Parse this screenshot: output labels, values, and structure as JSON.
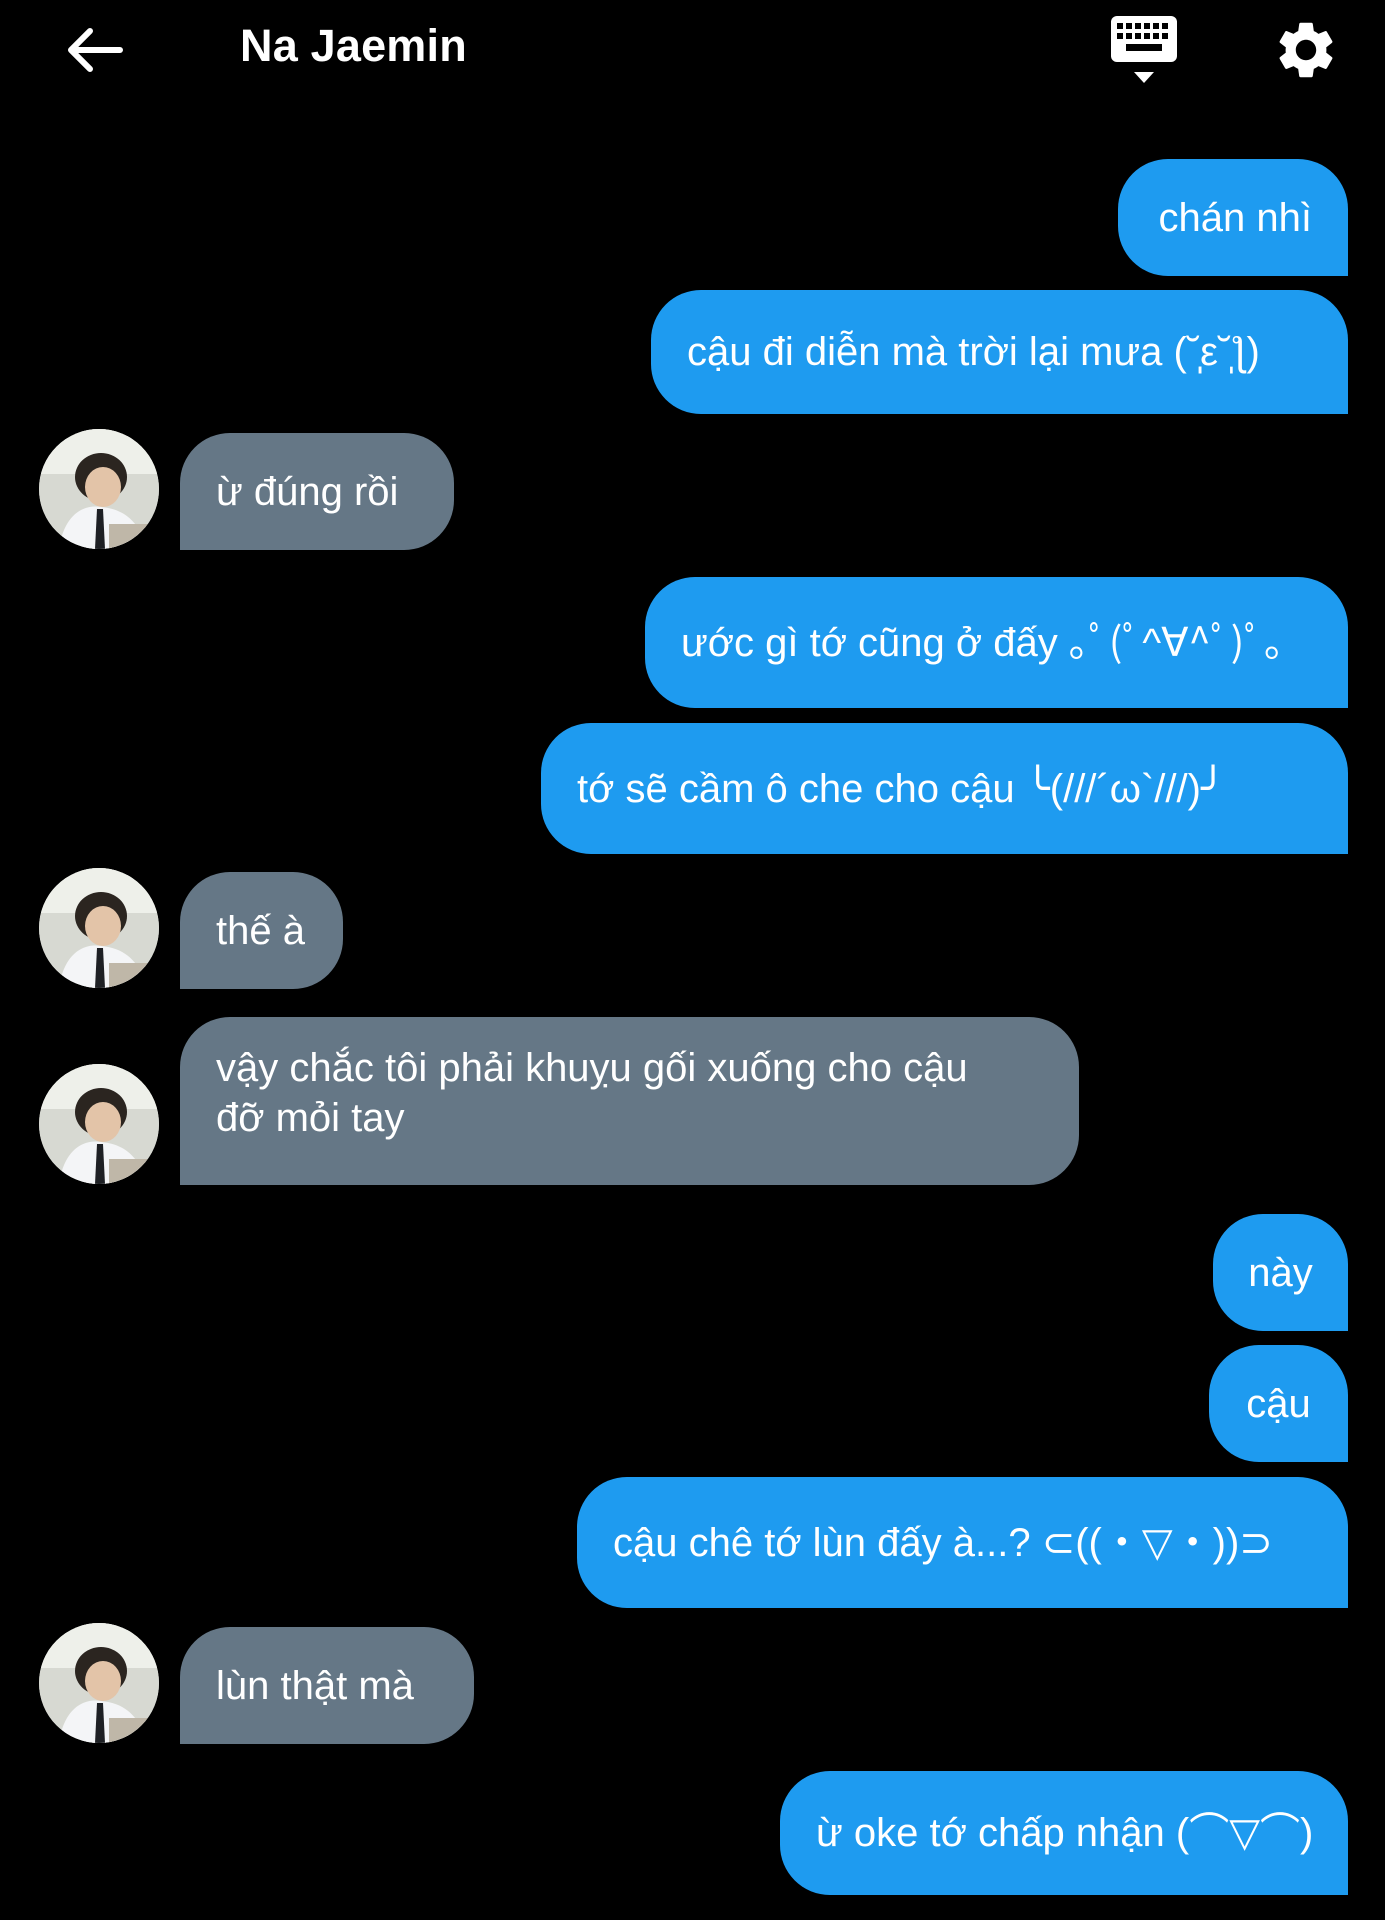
{
  "header": {
    "title": "Na Jaemin",
    "back_icon": "arrow-left-icon",
    "keyboard_icon": "keyboard-icon",
    "settings_icon": "gear-icon"
  },
  "colors": {
    "background": "#000000",
    "outgoing_bubble": "#1e9bf0",
    "incoming_bubble": "#657786",
    "text": "#ffffff"
  },
  "messages": [
    {
      "from": "me",
      "text": "chán nhì"
    },
    {
      "from": "me",
      "text": "cậu đi diễn mà trời lại mưa (˘̩̩̩ε˘̩ƪ)"
    },
    {
      "from": "them",
      "text": "ừ đúng rồi"
    },
    {
      "from": "me",
      "text": "ước gì tớ cũng ở đấy ｡ﾟ(ﾟ^∀^ﾟ)ﾟ｡"
    },
    {
      "from": "me",
      "text": "tớ sẽ cầm ô che cho cậu ╰(///´ω`///)╯"
    },
    {
      "from": "them",
      "text": "thế à"
    },
    {
      "from": "them",
      "text": "vậy chắc tôi phải khuỵu gối xuống cho cậu đỡ mỏi tay"
    },
    {
      "from": "me",
      "text": "này"
    },
    {
      "from": "me",
      "text": "cậu"
    },
    {
      "from": "me",
      "text": "cậu chê tớ lùn đấy à...? ⊂((・▽・))⊃"
    },
    {
      "from": "them",
      "text": "lùn thật mà"
    },
    {
      "from": "me",
      "text": "ừ oke tớ chấp nhận (⌒▽⌒)"
    }
  ]
}
